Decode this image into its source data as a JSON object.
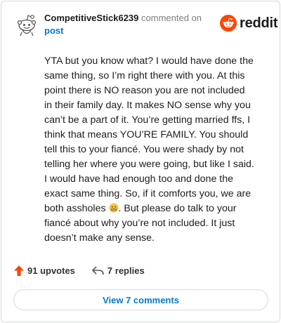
{
  "comment": {
    "username": "CompetitiveStick6239",
    "action_text": "commented on",
    "target_link": "post",
    "body_before_emoji": "YTA but you know what? I would have done the same thing, so I’m right there with you. At this point there is NO reason you are not included in their family day. It makes NO sense why you can’t be a part of it. You’re getting married ffs, I think that means YOU’RE FAMILY. You should tell this to your fiancé. You were shady by not telling her where you were going, but like I said. I would have had enough too and done the exact same thing. So, if it comforts you, we are both assholes ",
    "body_after_emoji": ". But please do talk to your fiancé about why you’re not included. It just doesn’t make any sense.",
    "emoji_icon": "grimacing-face-icon"
  },
  "brand": {
    "name": "reddit",
    "logo_icon": "reddit-snoo-icon",
    "accent_color": "#ff4500"
  },
  "stats": {
    "upvotes": "91 upvotes",
    "replies": "7 replies"
  },
  "view_button": {
    "label": "View 7 comments"
  },
  "colors": {
    "link": "#0079d3",
    "muted": "#7c7c7c",
    "border": "#d7dadc",
    "upvote": "#ff4500"
  }
}
